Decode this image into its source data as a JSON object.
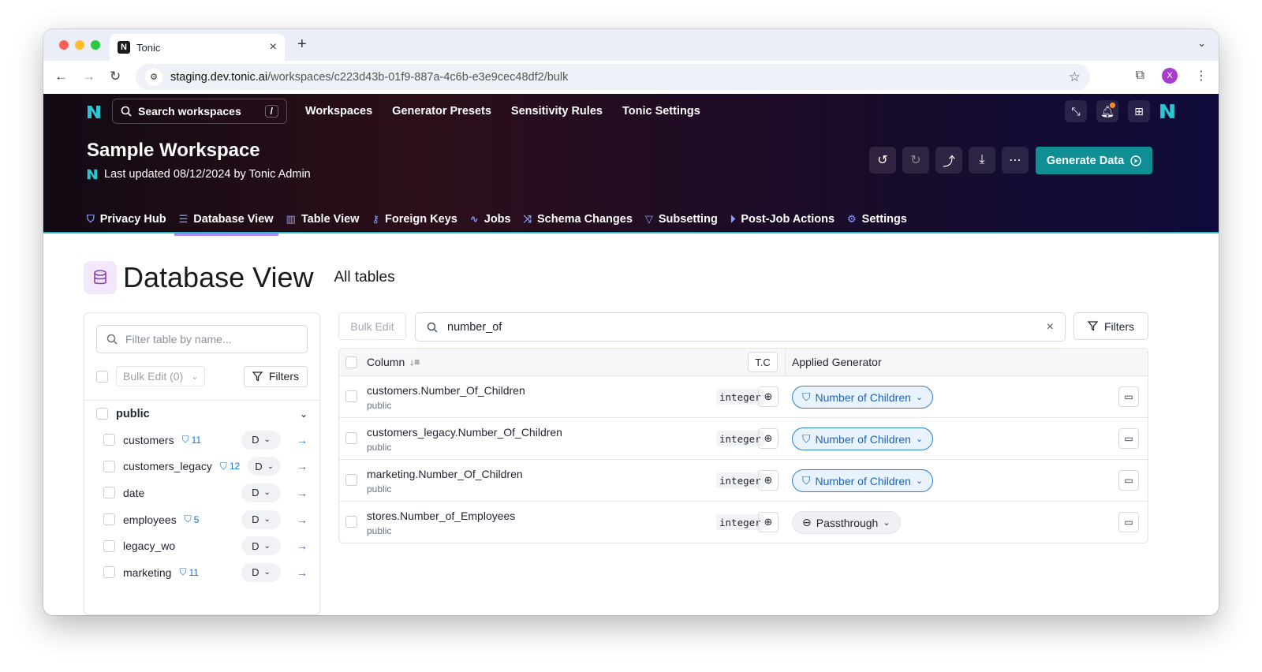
{
  "browser": {
    "tab_title": "Tonic",
    "tab_favicon": "N",
    "url_host": "staging.dev.tonic.ai",
    "url_path": "/workspaces/c223d43b-01f9-887a-4c6b-e3e9cec48df2/bulk",
    "profile_initial": "X"
  },
  "header": {
    "search_placeholder": "Search workspaces",
    "search_shortcut": "/",
    "nav": [
      "Workspaces",
      "Generator Presets",
      "Sensitivity Rules",
      "Tonic Settings"
    ],
    "workspace_title": "Sample Workspace",
    "last_updated": "Last updated 08/12/2024 by Tonic Admin",
    "generate_button": "Generate Data",
    "tabs": [
      {
        "label": "Privacy Hub",
        "icon": "shield-icon"
      },
      {
        "label": "Database View",
        "icon": "database-icon",
        "active": true
      },
      {
        "label": "Table View",
        "icon": "table-icon"
      },
      {
        "label": "Foreign Keys",
        "icon": "key-icon"
      },
      {
        "label": "Jobs",
        "icon": "activity-icon"
      },
      {
        "label": "Schema Changes",
        "icon": "shuffle-icon"
      },
      {
        "label": "Subsetting",
        "icon": "funnel-icon"
      },
      {
        "label": "Post-Job Actions",
        "icon": "skip-icon"
      },
      {
        "label": "Settings",
        "icon": "gear-icon"
      }
    ]
  },
  "page": {
    "title": "Database View",
    "subtitle": "All tables"
  },
  "sidebar": {
    "filter_placeholder": "Filter table by name...",
    "bulk_edit": "Bulk Edit (0)",
    "filters": "Filters",
    "schema": "public",
    "tables": [
      {
        "name": "customers",
        "badge": "11",
        "mode": "D"
      },
      {
        "name": "customers_legacy",
        "badge": "12",
        "mode": "D"
      },
      {
        "name": "date",
        "badge": "",
        "mode": "D"
      },
      {
        "name": "employees",
        "badge": "5",
        "mode": "D"
      },
      {
        "name": "legacy_wo",
        "badge": "",
        "mode": "D"
      },
      {
        "name": "marketing",
        "badge": "11",
        "mode": "D"
      }
    ]
  },
  "toolbar": {
    "bulk_edit": "Bulk Edit",
    "search_value": "number_of",
    "filters": "Filters"
  },
  "grid": {
    "col_header": "Column",
    "tc_header": "T.C",
    "gen_header": "Applied Generator",
    "rows": [
      {
        "column": "customers.Number_Of_Children",
        "schema": "public",
        "type": "integer",
        "generator": "Number of Children",
        "style": "blue"
      },
      {
        "column": "customers_legacy.Number_Of_Children",
        "schema": "public",
        "type": "integer",
        "generator": "Number of Children",
        "style": "blue"
      },
      {
        "column": "marketing.Number_Of_Children",
        "schema": "public",
        "type": "integer",
        "generator": "Number of Children",
        "style": "blue"
      },
      {
        "column": "stores.Number_of_Employees",
        "schema": "public",
        "type": "integer",
        "generator": "Passthrough",
        "style": "gray"
      }
    ]
  },
  "colors": {
    "accent_teal": "#0f8f94",
    "link_blue": "#1a73c7",
    "active_tab_underline": "#a78bfa"
  }
}
